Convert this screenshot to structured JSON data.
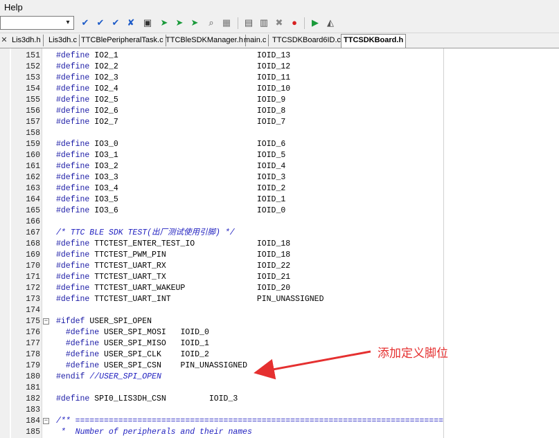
{
  "menu": {
    "help": "Help"
  },
  "toolbar": {
    "combo_value": "",
    "icons": [
      "bookmark-toggle-icon",
      "bookmark-next-icon",
      "bookmark-prev-icon",
      "bookmark-clear-icon",
      "open-file-icon",
      "indent-icon",
      "unindent-icon",
      "find-in-files-icon",
      "find-icon",
      "incremental-find-icon",
      "build-target-icon",
      "rebuild-icon",
      "batch-build-icon",
      "debug-icon",
      "start-debug-icon",
      "download-icon"
    ]
  },
  "tabs": [
    {
      "label": "Lis3dh.h"
    },
    {
      "label": "Lis3dh.c"
    },
    {
      "label": "TTCBlePeripheralTask.c"
    },
    {
      "label": "TTCBleSDKManager.h"
    },
    {
      "label": "main.c"
    },
    {
      "label": "TTCSDKBoard6ID.c"
    },
    {
      "label": "TTCSDKBoard.h"
    }
  ],
  "editor": {
    "lines": [
      {
        "n": "151",
        "kw": "#define",
        "text": " IO2_1                             IOID_13"
      },
      {
        "n": "152",
        "kw": "#define",
        "text": " IO2_2                             IOID_12"
      },
      {
        "n": "153",
        "kw": "#define",
        "text": " IO2_3                             IOID_11"
      },
      {
        "n": "154",
        "kw": "#define",
        "text": " IO2_4                             IOID_10"
      },
      {
        "n": "155",
        "kw": "#define",
        "text": " IO2_5                             IOID_9"
      },
      {
        "n": "156",
        "kw": "#define",
        "text": " IO2_6                             IOID_8"
      },
      {
        "n": "157",
        "kw": "#define",
        "text": " IO2_7                             IOID_7"
      },
      {
        "n": "158",
        "kw": "",
        "text": ""
      },
      {
        "n": "159",
        "kw": "#define",
        "text": " IO3_0                             IOID_6"
      },
      {
        "n": "160",
        "kw": "#define",
        "text": " IO3_1                             IOID_5"
      },
      {
        "n": "161",
        "kw": "#define",
        "text": " IO3_2                             IOID_4"
      },
      {
        "n": "162",
        "kw": "#define",
        "text": " IO3_3                             IOID_3"
      },
      {
        "n": "163",
        "kw": "#define",
        "text": " IO3_4                             IOID_2"
      },
      {
        "n": "164",
        "kw": "#define",
        "text": " IO3_5                             IOID_1"
      },
      {
        "n": "165",
        "kw": "#define",
        "text": " IO3_6                             IOID_0"
      },
      {
        "n": "166",
        "kw": "",
        "text": ""
      },
      {
        "n": "167",
        "comment": "/* TTC BLE SDK TEST(出厂测试使用引脚) */"
      },
      {
        "n": "168",
        "kw": "#define",
        "text": " TTCTEST_ENTER_TEST_IO             IOID_18"
      },
      {
        "n": "169",
        "kw": "#define",
        "text": " TTCTEST_PWM_PIN                   IOID_18"
      },
      {
        "n": "170",
        "kw": "#define",
        "text": " TTCTEST_UART_RX                   IOID_22"
      },
      {
        "n": "171",
        "kw": "#define",
        "text": " TTCTEST_UART_TX                   IOID_21"
      },
      {
        "n": "172",
        "kw": "#define",
        "text": " TTCTEST_UART_WAKEUP               IOID_20"
      },
      {
        "n": "173",
        "kw": "#define",
        "text": " TTCTEST_UART_INT                  PIN_UNASSIGNED"
      },
      {
        "n": "174",
        "kw": "",
        "text": ""
      },
      {
        "n": "175",
        "fold": "−",
        "kw": "#ifdef",
        "text": " USER_SPI_OPEN"
      },
      {
        "n": "176",
        "indent": "  ",
        "kw": "#define",
        "text": " USER_SPI_MOSI   IOID_0"
      },
      {
        "n": "177",
        "indent": "  ",
        "kw": "#define",
        "text": " USER_SPI_MISO   IOID_1"
      },
      {
        "n": "178",
        "indent": "  ",
        "kw": "#define",
        "text": " USER_SPI_CLK    IOID_2"
      },
      {
        "n": "179",
        "indent": "  ",
        "kw": "#define",
        "text": " USER_SPI_CSN    PIN_UNASSIGNED"
      },
      {
        "n": "180",
        "kw": "#endif",
        "comment_tail": " //USER_SPI_OPEN"
      },
      {
        "n": "181",
        "kw": "",
        "text": ""
      },
      {
        "n": "182",
        "kw": "#define",
        "text": " SPI0_LIS3DH_CSN         IOID_3"
      },
      {
        "n": "183",
        "kw": "",
        "text": ""
      },
      {
        "n": "184",
        "fold": "−",
        "comment": "/** ============================================================================="
      },
      {
        "n": "185",
        "comment": " *  Number of peripherals and their names"
      }
    ]
  },
  "annotation": {
    "text": "添加定义脚位",
    "color": "#e53030"
  }
}
